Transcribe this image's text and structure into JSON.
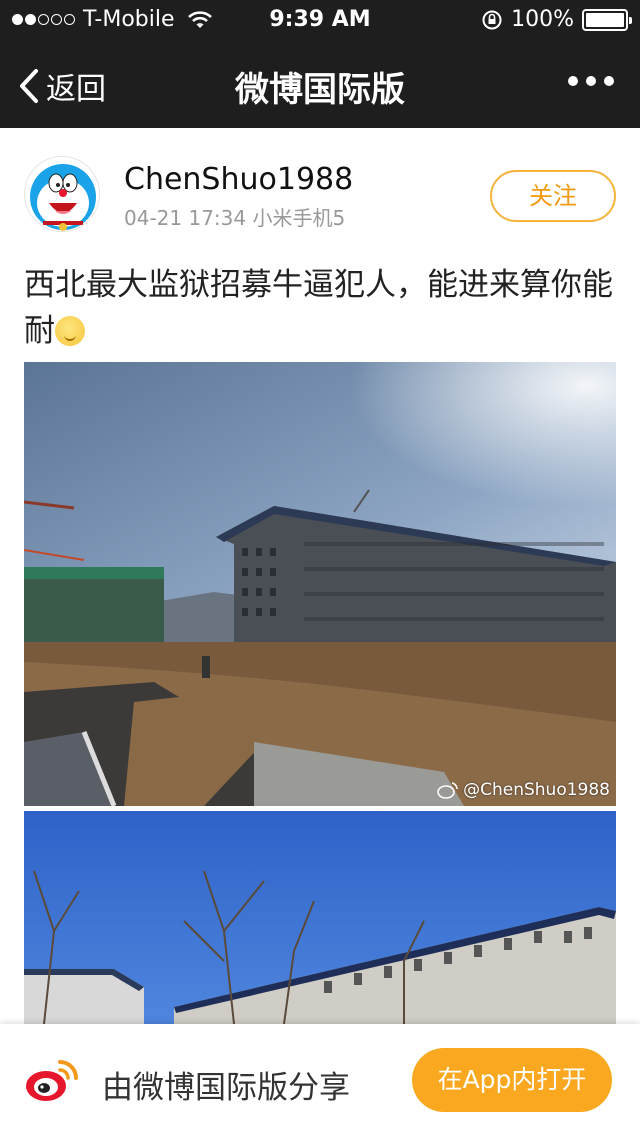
{
  "status_bar": {
    "carrier": "T-Mobile",
    "signal_dots": [
      1,
      1,
      0,
      0,
      0
    ],
    "time": "9:39 AM",
    "battery": "100%"
  },
  "nav": {
    "back_label": "返回",
    "title": "微博国际版"
  },
  "post": {
    "username": "ChenShuo1988",
    "timestamp": "04-21 17:34",
    "device": "小米手机5",
    "follow_label": "关注",
    "text": "西北最大监狱招募牛逼犯人，能进来算你能耐",
    "emoji": "smirk-emoji",
    "watermark": "@ChenShuo1988"
  },
  "share_bar": {
    "text": "由微博国际版分享",
    "open_label": "在App内打开"
  },
  "colors": {
    "bar_bg": "#1e1e1e",
    "accent_orange": "#f9a820",
    "weibo_red": "#e6162d"
  }
}
